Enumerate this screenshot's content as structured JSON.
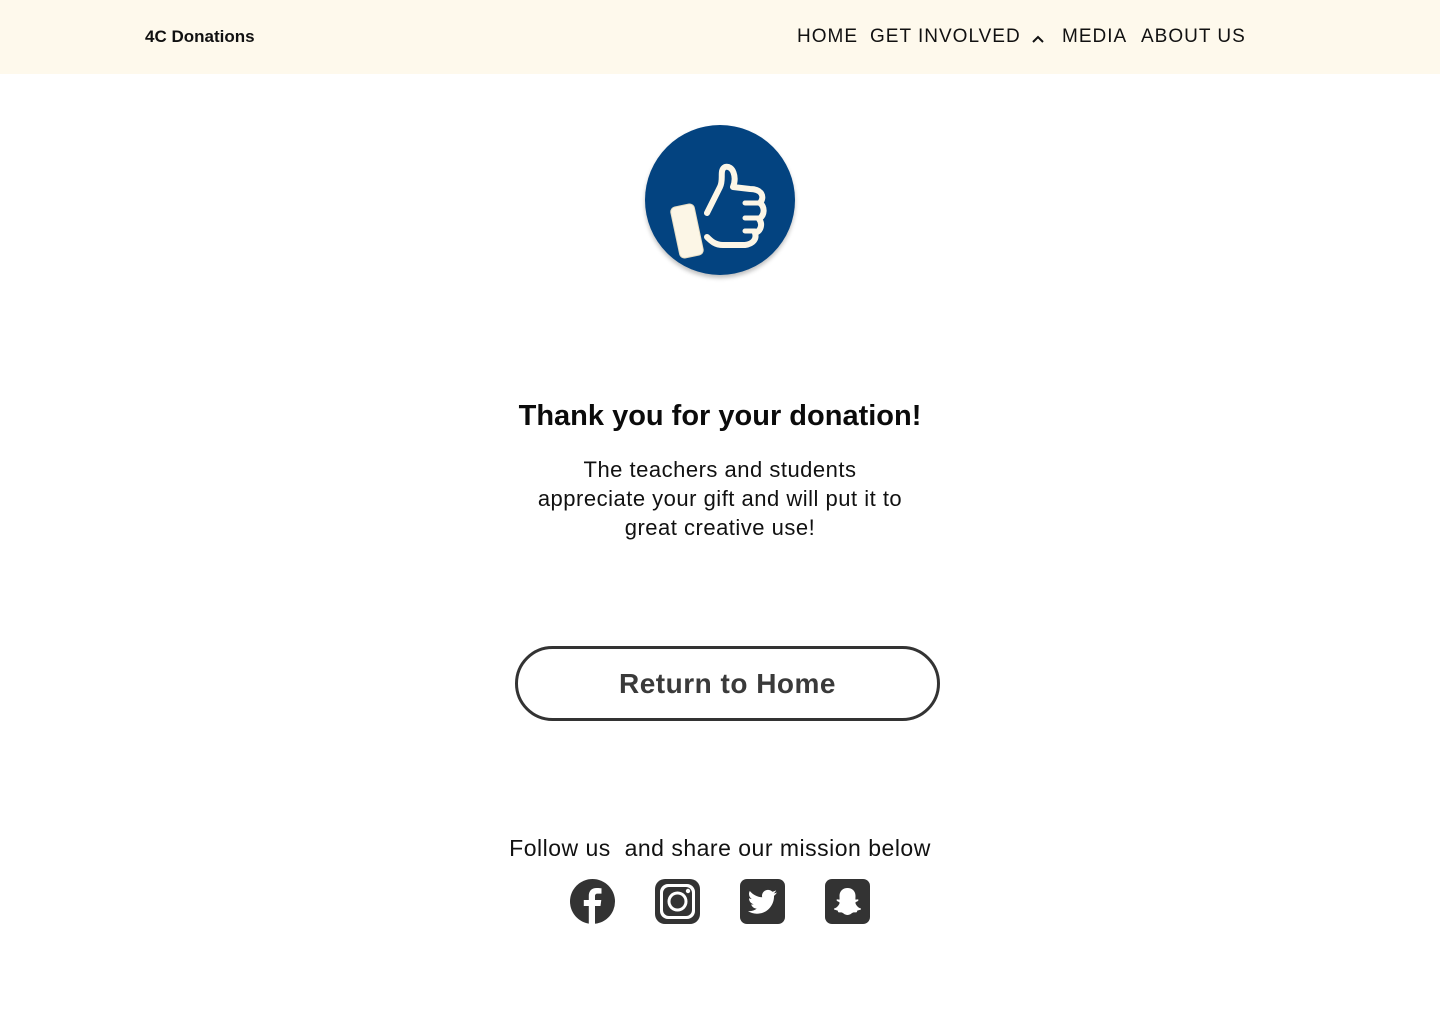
{
  "header": {
    "brand": "4C Donations",
    "nav": {
      "home": "HOME",
      "get_involved": "GET INVOLVED",
      "media": "MEDIA",
      "about": "ABOUT US"
    },
    "background_color": "#fef9ec"
  },
  "hero": {
    "icon": "thumbs-up-icon",
    "icon_color": "#034380"
  },
  "main": {
    "heading": "Thank you for your donation!",
    "message": "The teachers and students appreciate your gift and will put it to great creative use!",
    "return_button": "Return to Home"
  },
  "footer": {
    "follow_text": "Follow us  and share our mission below",
    "social_icons": [
      "facebook-icon",
      "instagram-icon",
      "twitter-icon",
      "snapchat-icon"
    ],
    "icon_color": "#333333"
  }
}
